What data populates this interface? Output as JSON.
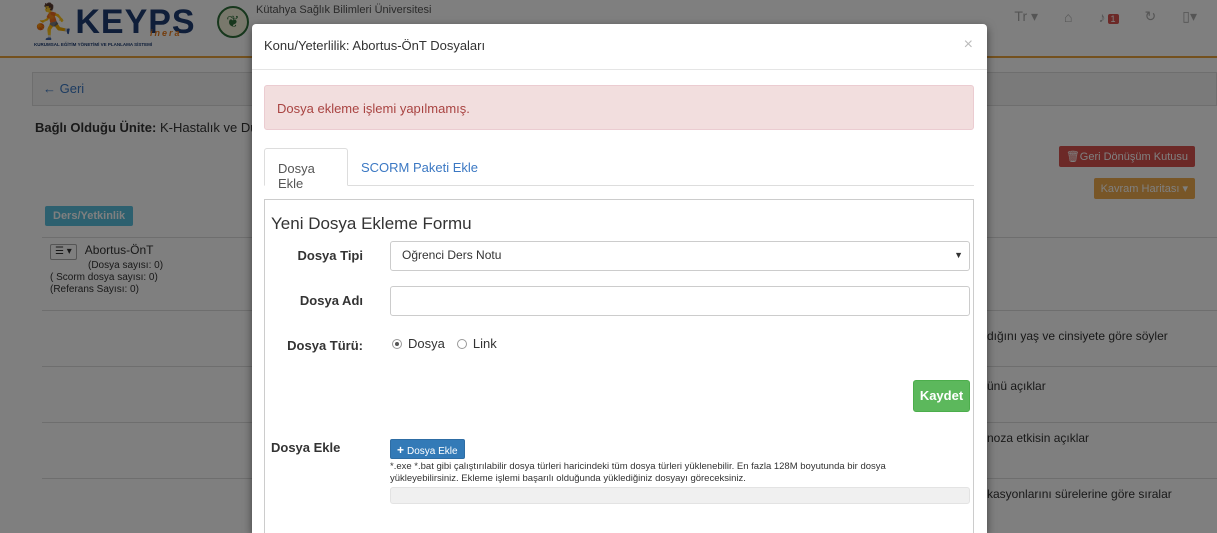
{
  "header": {
    "logo_text": "KEYPS",
    "logo_tagline": "inera",
    "logo_subtitle": "KURUMSAL EĞİTİM YÖNETİMİ VE PLANLAMA SİSTEMİ",
    "university": "Kütahya Sağlık Bilimleri Üniversitesi",
    "language": "Tr ▾",
    "notifications_count": "1"
  },
  "page": {
    "back_label": "← Geri",
    "unit_label": "Bağlı Olduğu Ünite:",
    "unit_value": "K-Hastalık ve Duru",
    "recycle_bin_label": "🗑Geri Dönüşüm Kutusu",
    "concept_map_label": "Kavram Haritası ▾",
    "course_tag": "Ders/Yetkinlik",
    "item": {
      "menu": "☰ ▾",
      "title": "Abortus-ÖnT",
      "file_count": "(Dosya sayısı: 0)",
      "scorm_count": "( Scorm dosya sayısı: 0)",
      "ref_count": "(Referans Sayısı: 0)"
    },
    "row_texts": [
      "dığını yaş ve cinsiyete göre söyler",
      "ünü açıklar",
      "noza etkisin açıklar",
      "kasyonlarını sürelerine göre sıralar"
    ]
  },
  "modal": {
    "title": "Konu/Yeterlilik: Abortus-ÖnT Dosyaları",
    "close": "×",
    "alert": "Dosya ekleme işlemi yapılmamış.",
    "tabs": [
      {
        "label": "Dosya Ekle",
        "active": true
      },
      {
        "label": "SCORM Paketi Ekle",
        "active": false
      }
    ],
    "form": {
      "title": "Yeni Dosya Ekleme Formu",
      "file_type_label": "Dosya Tipi",
      "file_type_value": "Oğrenci Ders Notu",
      "file_name_label": "Dosya Adı",
      "file_name_value": "",
      "file_kind_label": "Dosya Türü:",
      "radio_file": "Dosya",
      "radio_link": "Link",
      "save_label": "Kaydet",
      "upload_label": "Dosya Ekle",
      "upload_button": "Dosya Ekle",
      "upload_help": "*.exe *.bat gibi çalıştırılabilir dosya türleri haricindeki tüm dosya türleri yüklenebilir. En fazla 128M boyutunda bir dosya yükleyebilirsiniz. Ekleme işlemi başarılı olduğunda yüklediğiniz dosyayı göreceksiniz."
    }
  },
  "colors": {
    "accent": "#e8a33d",
    "link": "#3b78c3",
    "danger": "#d9534f",
    "success": "#5cb85c",
    "primary": "#337ab7"
  }
}
